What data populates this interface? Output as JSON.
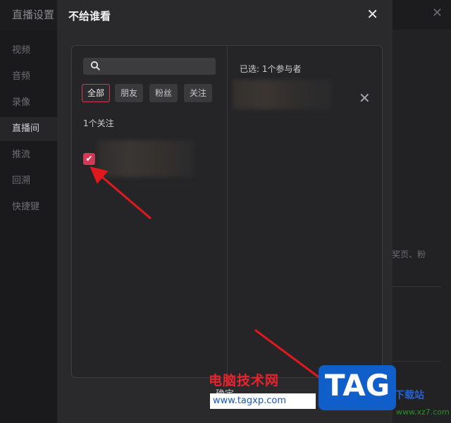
{
  "background": {
    "window_title": "直播设置",
    "sidebar": [
      {
        "label": "视频"
      },
      {
        "label": "音频"
      },
      {
        "label": "录像"
      },
      {
        "label": "直播间"
      },
      {
        "label": "推流"
      },
      {
        "label": "回溯"
      },
      {
        "label": "快捷键"
      }
    ],
    "hint_text": "奖页、粉"
  },
  "modal": {
    "title": "不给谁看",
    "search": {
      "placeholder": "",
      "value": ""
    },
    "tabs": [
      {
        "label": "全部",
        "active": true
      },
      {
        "label": "朋友",
        "active": false
      },
      {
        "label": "粉丝",
        "active": false
      },
      {
        "label": "关注",
        "active": false
      }
    ],
    "count_label": "1个关注",
    "item_checked": true,
    "selected_label": "已选: 1个参与者",
    "bottom_button": "确定"
  },
  "watermark": {
    "title": "电脑技术网",
    "url": "www.tagxp.com",
    "logo": "TAG",
    "site_cn": "下载站",
    "site_en": "www.xz7.com"
  },
  "colors": {
    "accent": "#d23a58",
    "arrow": "#e0191f"
  }
}
